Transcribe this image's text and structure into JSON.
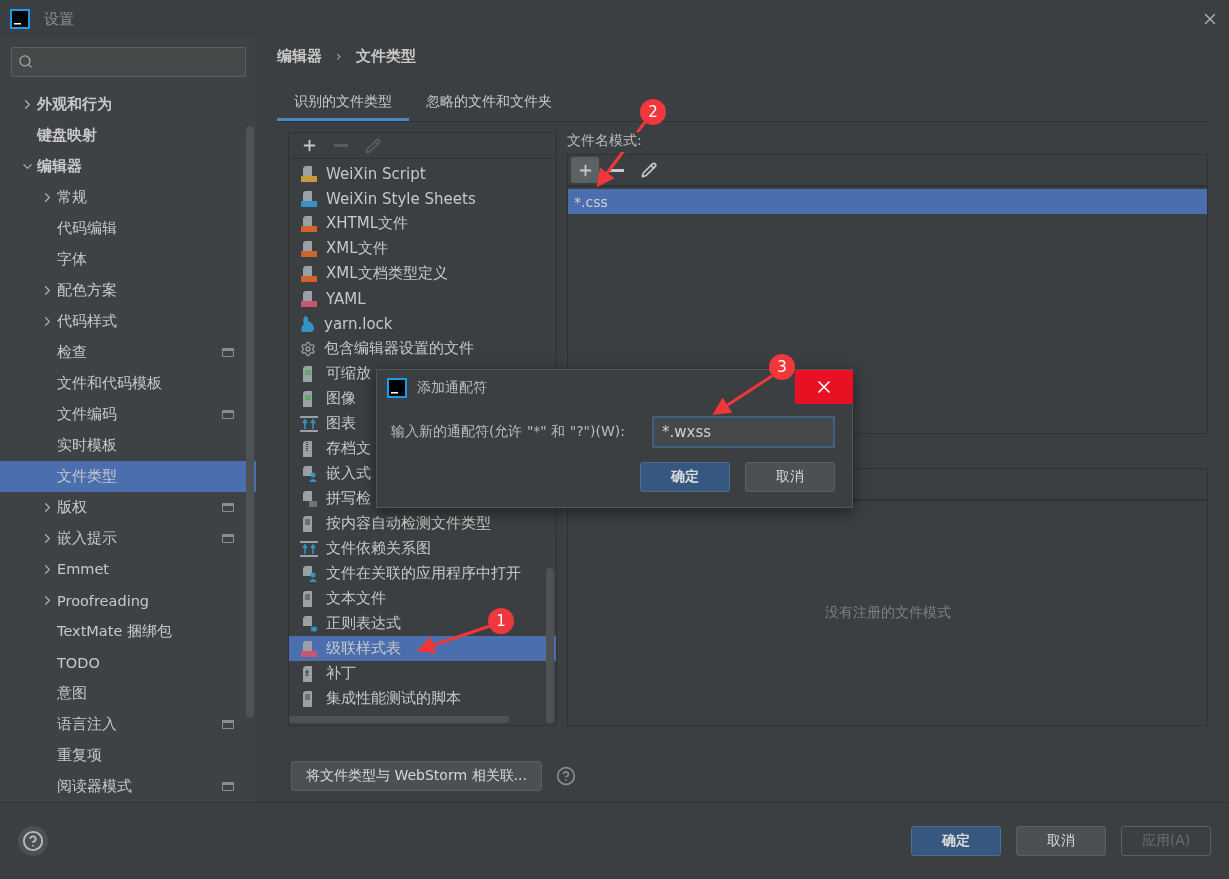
{
  "window": {
    "title": "设置"
  },
  "sidebar": {
    "items": [
      {
        "label": "外观和行为",
        "expanded": false,
        "selected": false,
        "marked": false
      },
      {
        "label": "键盘映射",
        "selected": false,
        "marked": false
      },
      {
        "label": "编辑器",
        "expanded": true,
        "selected": false,
        "marked": false,
        "children": [
          {
            "label": "常规",
            "expanded": false,
            "selected": false,
            "marked": false
          },
          {
            "label": "代码编辑",
            "selected": false,
            "marked": false
          },
          {
            "label": "字体",
            "selected": false,
            "marked": false
          },
          {
            "label": "配色方案",
            "expanded": false,
            "selected": false,
            "marked": false
          },
          {
            "label": "代码样式",
            "expanded": false,
            "selected": false,
            "marked": false
          },
          {
            "label": "检查",
            "selected": false,
            "marked": true
          },
          {
            "label": "文件和代码模板",
            "selected": false,
            "marked": false
          },
          {
            "label": "文件编码",
            "selected": false,
            "marked": true
          },
          {
            "label": "实时模板",
            "selected": false,
            "marked": false
          },
          {
            "label": "文件类型",
            "selected": true,
            "marked": false
          },
          {
            "label": "版权",
            "expanded": false,
            "selected": false,
            "marked": true
          },
          {
            "label": "嵌入提示",
            "expanded": false,
            "selected": false,
            "marked": true
          },
          {
            "label": "Emmet",
            "expanded": false,
            "selected": false,
            "marked": false
          },
          {
            "label": "Proofreading",
            "expanded": false,
            "selected": false,
            "marked": false
          },
          {
            "label": "TextMate 捆绑包",
            "selected": false,
            "marked": false
          },
          {
            "label": "TODO",
            "selected": false,
            "marked": false
          },
          {
            "label": "意图",
            "selected": false,
            "marked": false
          },
          {
            "label": "语言注入",
            "selected": false,
            "marked": true
          },
          {
            "label": "重复项",
            "selected": false,
            "marked": false
          },
          {
            "label": "阅读器模式",
            "selected": false,
            "marked": true
          }
        ]
      }
    ]
  },
  "breadcrumb": {
    "items": [
      "编辑器",
      "文件类型"
    ],
    "separator": "›"
  },
  "tabs": [
    {
      "label": "识别的文件类型",
      "selected": true
    },
    {
      "label": "忽略的文件和文件夹",
      "selected": false
    }
  ],
  "file_types": {
    "toolbar": [
      {
        "kind": "add",
        "disabled": false
      },
      {
        "kind": "remove",
        "disabled": true
      },
      {
        "kind": "edit",
        "disabled": true
      }
    ],
    "items": [
      {
        "kind": "wxs",
        "label": "WeiXin Script",
        "selected": false
      },
      {
        "kind": "wxss",
        "label": "WeiXin Style Sheets",
        "selected": false
      },
      {
        "kind": "html",
        "label": "XHTML文件",
        "selected": false
      },
      {
        "kind": "xml",
        "label": "XML文件",
        "selected": false
      },
      {
        "kind": "dtd",
        "label": "XML文档类型定义",
        "selected": false
      },
      {
        "kind": "yaml",
        "label": "YAML",
        "selected": false
      },
      {
        "kind": "yarn",
        "label": "yarn.lock",
        "selected": false
      },
      {
        "kind": "gear",
        "label": "包含编辑器设置的文件",
        "selected": false
      },
      {
        "kind": "image",
        "label": "可缩放",
        "selected": false
      },
      {
        "kind": "image",
        "label": "图像",
        "selected": false
      },
      {
        "kind": "chart",
        "label": "图表",
        "selected": false
      },
      {
        "kind": "archive",
        "label": "存档文",
        "selected": false
      },
      {
        "kind": "person",
        "label": "嵌入式",
        "selected": false
      },
      {
        "kind": "spell",
        "label": "拼写检",
        "selected": false
      },
      {
        "kind": "text",
        "label": "按内容自动检测文件类型",
        "selected": false
      },
      {
        "kind": "chart",
        "label": "文件依赖关系图",
        "selected": false
      },
      {
        "kind": "person",
        "label": "文件在关联的应用程序中打开",
        "selected": false
      },
      {
        "kind": "text",
        "label": "文本文件",
        "selected": false
      },
      {
        "kind": "regex",
        "label": "正则表达式",
        "selected": false
      },
      {
        "kind": "css",
        "label": "级联样式表",
        "selected": true
      },
      {
        "kind": "patch",
        "label": "补丁",
        "selected": false
      },
      {
        "kind": "text",
        "label": "集成性能测试的脚本",
        "selected": false
      }
    ]
  },
  "patterns": {
    "label": "文件名模式:",
    "toolbar": [
      {
        "kind": "add",
        "highlighted": true
      },
      {
        "kind": "remove",
        "highlighted": false
      },
      {
        "kind": "edit",
        "highlighted": false
      }
    ],
    "items": [
      {
        "label": "*.css",
        "selected": true
      }
    ]
  },
  "registered": {
    "empty_text": "没有注册的文件模式"
  },
  "associate_button": "将文件类型与 WebStorm 相关联...",
  "dialog": {
    "title": "添加通配符",
    "label": "输入新的通配符(允许 \"*\" 和 \"?\")(W):",
    "value": "*.wxss",
    "ok": "确定",
    "cancel": "取消"
  },
  "footer": {
    "buttons": [
      {
        "label": "确定",
        "kind": "primary",
        "disabled": false
      },
      {
        "label": "取消",
        "kind": "normal",
        "disabled": false
      },
      {
        "label": "应用(A)",
        "kind": "normal",
        "disabled": true
      }
    ]
  },
  "annotations": [
    {
      "label": "1"
    },
    {
      "label": "2"
    },
    {
      "label": "3"
    }
  ]
}
